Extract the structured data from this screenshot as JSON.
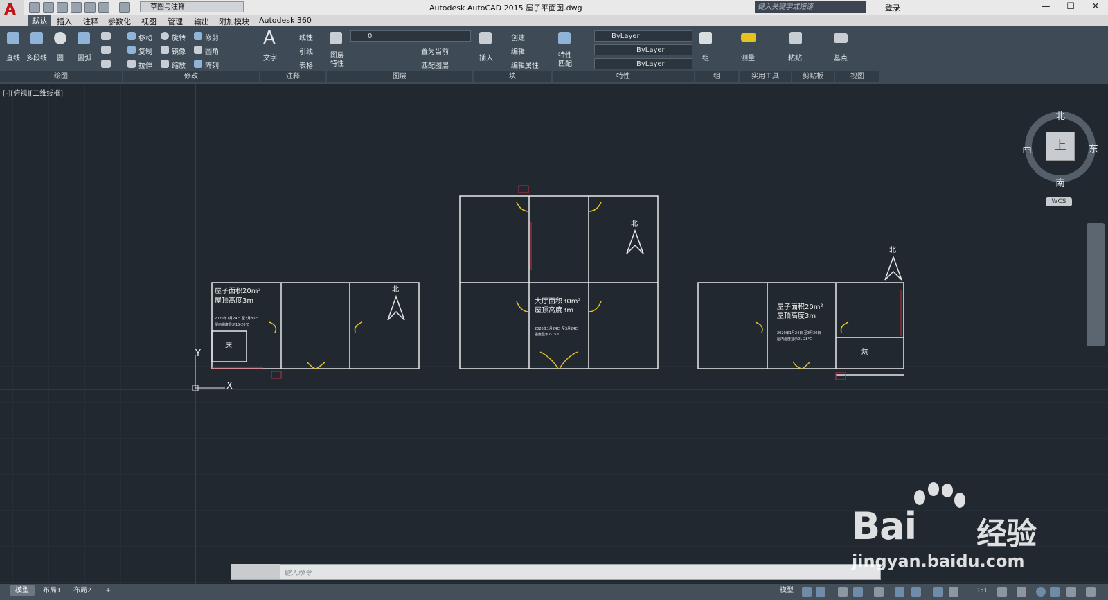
{
  "window": {
    "title": "Autodesk AutoCAD 2015      屋子平面图.dwg",
    "workspace": "草图与注释",
    "search_placeholder": "键入关键字或短语",
    "login_label": "登录"
  },
  "tabs": [
    "默认",
    "插入",
    "注释",
    "参数化",
    "视图",
    "管理",
    "输出",
    "附加模块",
    "Autodesk 360"
  ],
  "ribbon": {
    "draw": {
      "line": "直线",
      "polyline": "多段线",
      "circle": "圆",
      "arc": "圆弧",
      "panel": "绘图"
    },
    "modify": {
      "move": "移动",
      "rotate": "旋转",
      "trim": "修剪",
      "copy": "复制",
      "mirror": "镜像",
      "fillet": "圆角",
      "stretch": "拉伸",
      "scale": "缩放",
      "array": "阵列",
      "panel": "修改"
    },
    "annotation": {
      "text": "文字",
      "linear": "线性",
      "leader": "引线",
      "table": "表格",
      "panel": "注释"
    },
    "layers": {
      "props": "图层\n特性",
      "current_layer": "0",
      "set_current": "置为当前",
      "match": "匹配图层",
      "panel": "图层"
    },
    "block": {
      "insert": "插入",
      "create": "创建",
      "edit": "编辑",
      "edit_attr": "编辑属性",
      "panel": "块"
    },
    "properties": {
      "match": "特性\n匹配",
      "color": "ByLayer",
      "linetype": "ByLayer",
      "lineweight": "ByLayer",
      "panel": "特性"
    },
    "group": {
      "label": "组",
      "panel": "组"
    },
    "utilities": {
      "measure": "测量",
      "panel": "实用工具"
    },
    "clipboard": {
      "paste": "粘贴",
      "panel": "剪贴板"
    },
    "view": {
      "base": "基点",
      "panel": "视图"
    }
  },
  "viewport": {
    "label": "[-][俯视][二维线框]",
    "compass": {
      "n": "北",
      "s": "南",
      "e": "东",
      "w": "西",
      "top": "上",
      "wcs": "WCS"
    }
  },
  "drawing": {
    "house1": {
      "area": "屋子面积20m²",
      "height": "屋顶高度3m",
      "note1": "2020年1月24日 至3月30日",
      "note2": "屋内温度显示15-20℃",
      "bed": "床",
      "north": "北"
    },
    "house2": {
      "area": "大厅面积30m²",
      "height": "屋顶高度3m",
      "note1": "2020年1月24日 至3月24日",
      "note2": "温度显示7-15℃",
      "north": "北"
    },
    "house3": {
      "area": "屋子面积20m²",
      "height": "屋顶高度3m",
      "note1": "2020年1月24日 至3月30日",
      "note2": "屋内温度显示21-28℃",
      "kang": "炕",
      "north": "北"
    },
    "ucs": {
      "x": "X",
      "y": "Y"
    }
  },
  "command": {
    "placeholder": "键入命令"
  },
  "layouts": [
    "模型",
    "布局1",
    "布局2",
    "+"
  ],
  "status": {
    "model": "模型",
    "scale": "1:1"
  },
  "watermark": {
    "brand": "Bai",
    "brand2": "经验",
    "url": "jingyan.baidu.com"
  }
}
